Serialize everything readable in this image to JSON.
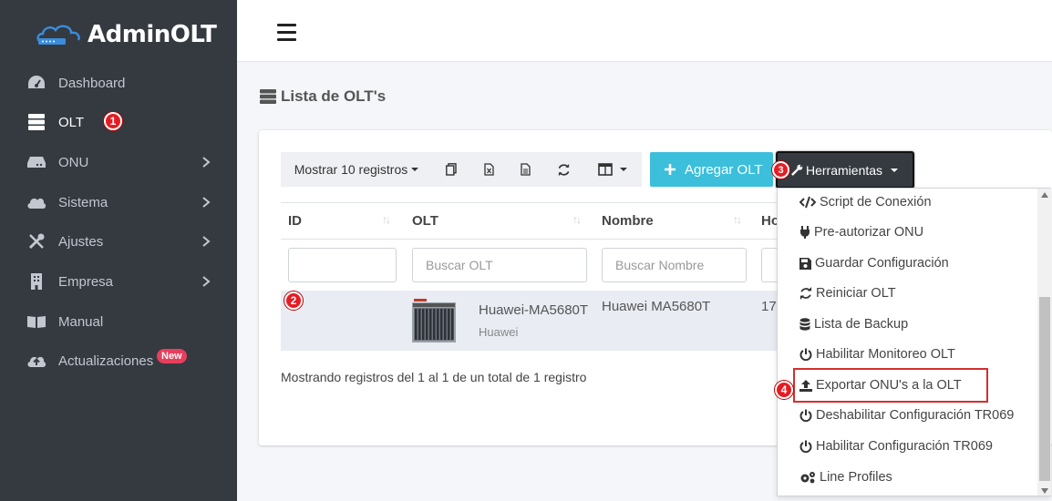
{
  "brand": {
    "name": "AdminOLT"
  },
  "sidebar": {
    "items": [
      {
        "label": "Dashboard",
        "icon": "dashboard-icon"
      },
      {
        "label": "OLT",
        "icon": "server-icon",
        "step": "1"
      },
      {
        "label": "ONU",
        "icon": "hdd-icon"
      },
      {
        "label": "Sistema",
        "icon": "cloud-icon"
      },
      {
        "label": "Ajustes",
        "icon": "tools-icon"
      },
      {
        "label": "Empresa",
        "icon": "building-icon"
      },
      {
        "label": "Manual",
        "icon": "book-icon"
      },
      {
        "label": "Actualizaciones",
        "icon": "cloud-upload-icon",
        "badge": "New"
      }
    ]
  },
  "page": {
    "title": "Lista de OLT's"
  },
  "toolbar": {
    "show_records": "Mostrar 10 registros",
    "add_label": "Agregar OLT",
    "tools_label": "Herramientas",
    "tools_step": "3"
  },
  "table": {
    "headers": [
      "ID",
      "OLT",
      "Nombre",
      "Ho"
    ],
    "search_placeholders": {
      "olt": "Buscar OLT",
      "nombre": "Buscar Nombre"
    },
    "row": {
      "step": "2",
      "olt_model": "Huawei-MA5680T",
      "olt_brand": "Huawei",
      "nombre": "Huawei MA5680T",
      "host_partial": "17"
    },
    "footer": "Mostrando registros del 1 al 1 de un total de 1 registro"
  },
  "dropdown": {
    "items": [
      {
        "label": "Script de Conexión",
        "icon": "code-icon"
      },
      {
        "label": "Pre-autorizar ONU",
        "icon": "plug-icon"
      },
      {
        "label": "Guardar Configuración",
        "icon": "save-icon"
      },
      {
        "label": "Reiniciar OLT",
        "icon": "sync-icon"
      },
      {
        "label": "Lista de Backup",
        "icon": "database-icon"
      },
      {
        "label": "Habilitar Monitoreo OLT",
        "icon": "power-icon"
      },
      {
        "label": "Exportar ONU's a la OLT",
        "icon": "upload-icon",
        "step": "4"
      },
      {
        "label": "Deshabilitar Configuración TR069",
        "icon": "power-icon"
      },
      {
        "label": "Habilitar Configuración TR069",
        "icon": "power-icon"
      },
      {
        "label": "Line Profiles",
        "icon": "cogs-icon"
      }
    ]
  },
  "colors": {
    "sidebar": "#343a40",
    "accent": "#3bbfdb",
    "marker": "#e51c23"
  }
}
